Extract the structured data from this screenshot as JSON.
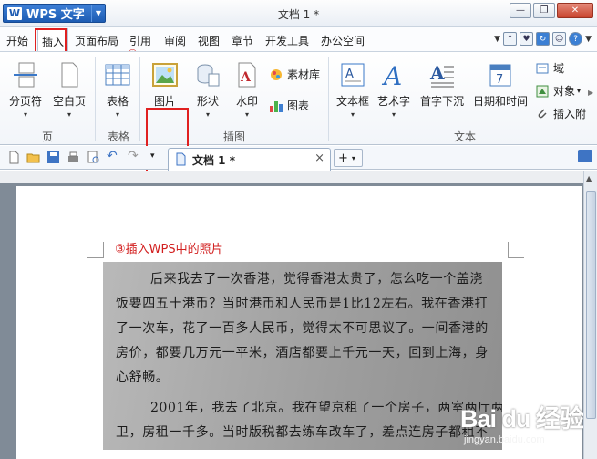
{
  "app": {
    "name": "WPS 文字",
    "logo_letter": "W",
    "window_title": "文档 1 *",
    "brand_color": "#1d5cb3"
  },
  "menu": {
    "tabs": [
      "开始",
      "插入",
      "页面布局",
      "引用",
      "审阅",
      "视图",
      "章节",
      "开发工具",
      "办公空间"
    ],
    "active_tab": "插入"
  },
  "annotations": {
    "step1": "①",
    "step2": "②",
    "step3_caption": "③插入WPS中的照片",
    "highlight_color": "#e02020"
  },
  "ribbon": {
    "page_group": {
      "label": "页",
      "page_break": "分页符",
      "blank_page": "空白页"
    },
    "table_group": {
      "label": "表格",
      "table": "表格"
    },
    "illustration_group": {
      "label": "插图",
      "picture": "图片",
      "shapes": "形状",
      "watermark": "水印",
      "clipart": "素材库",
      "chart": "图表"
    },
    "text_group": {
      "label": "文本",
      "textbox": "文本框",
      "wordart": "艺术字",
      "dropcap": "首字下沉",
      "datetime": "日期和时间",
      "field": "域",
      "object": "对象",
      "attachment": "插入附"
    }
  },
  "document_tab": {
    "label": "文档 1 *",
    "close": "×",
    "new_tab": "+"
  },
  "photo_text": [
    "后来我去了一次香港，觉得香港太贵了，怎么吃一个盖浇",
    "饭要四五十港币？当时港币和人民币是1比12左右。我在香港打",
    "了一次车，花了一百多人民币，觉得太不可思议了。一间香港的",
    "房价，都要几万元一平米，酒店都要上千元一天，回到上海，身",
    "心舒畅。",
    "2001年，我去了北京。我在望京租了一个房子，两室两厅两",
    "卫，房租一千多。当时版税都去练车改车了，差点连房子都租不"
  ],
  "watermark": {
    "main": "Bai du 经验",
    "sub": "jingyan.baidu.com"
  }
}
